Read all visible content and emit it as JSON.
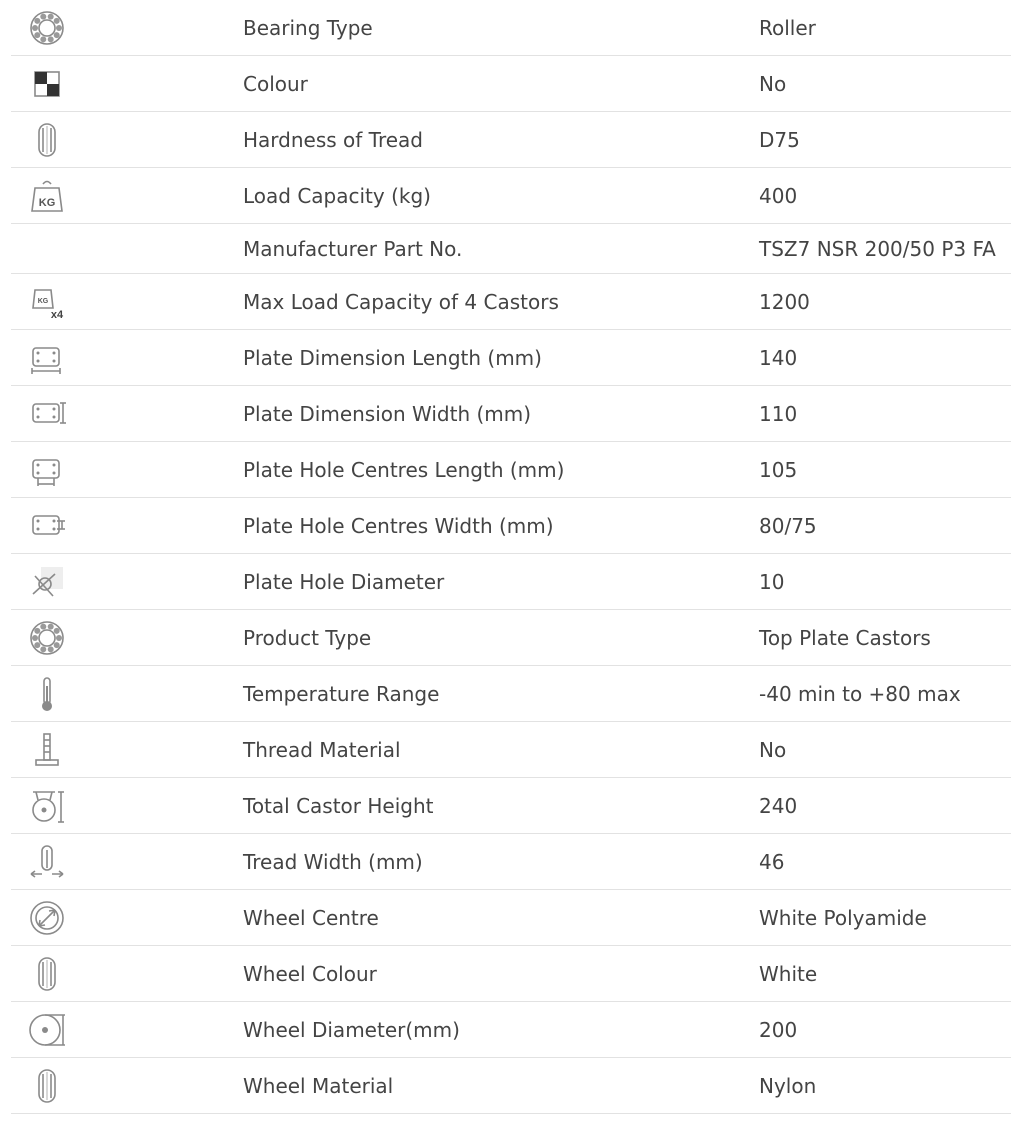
{
  "specs": [
    {
      "icon": "bearing-icon",
      "label": "Bearing Type",
      "value": "Roller"
    },
    {
      "icon": "colour-swatch-icon",
      "label": "Colour",
      "value": "No"
    },
    {
      "icon": "wheel-tread-icon",
      "label": "Hardness of Tread",
      "value": "D75"
    },
    {
      "icon": "weight-kg-icon",
      "label": "Load Capacity (kg)",
      "value": "400",
      "icon_text": "KG"
    },
    {
      "icon": "",
      "label": "Manufacturer Part No.",
      "value": "TSZ7 NSR 200/50 P3 FA"
    },
    {
      "icon": "weight-kg-x4-icon",
      "label": "Max Load Capacity of 4 Castors",
      "value": "1200",
      "icon_text": "KG",
      "icon_text_2": "x4"
    },
    {
      "icon": "plate-length-icon",
      "label": "Plate Dimension Length (mm)",
      "value": "140"
    },
    {
      "icon": "plate-width-icon",
      "label": "Plate Dimension Width (mm)",
      "value": "110"
    },
    {
      "icon": "plate-hole-length-icon",
      "label": "Plate Hole Centres Length (mm)",
      "value": "105"
    },
    {
      "icon": "plate-hole-width-icon",
      "label": "Plate Hole Centres Width (mm)",
      "value": "80/75"
    },
    {
      "icon": "hole-diameter-icon",
      "label": "Plate Hole Diameter",
      "value": "10"
    },
    {
      "icon": "product-type-icon",
      "label": "Product Type",
      "value": "Top Plate Castors"
    },
    {
      "icon": "thermometer-icon",
      "label": "Temperature Range",
      "value": "-40 min to +80 max"
    },
    {
      "icon": "thread-stem-icon",
      "label": "Thread Material",
      "value": "No"
    },
    {
      "icon": "castor-height-icon",
      "label": "Total Castor Height",
      "value": "240"
    },
    {
      "icon": "tread-width-icon",
      "label": "Tread Width (mm)",
      "value": "46"
    },
    {
      "icon": "wheel-centre-icon",
      "label": "Wheel Centre",
      "value": "White Polyamide"
    },
    {
      "icon": "wheel-colour-icon",
      "label": "Wheel Colour",
      "value": "White"
    },
    {
      "icon": "wheel-diameter-icon",
      "label": "Wheel Diameter(mm)",
      "value": "200"
    },
    {
      "icon": "wheel-material-icon",
      "label": "Wheel Material",
      "value": "Nylon"
    }
  ]
}
